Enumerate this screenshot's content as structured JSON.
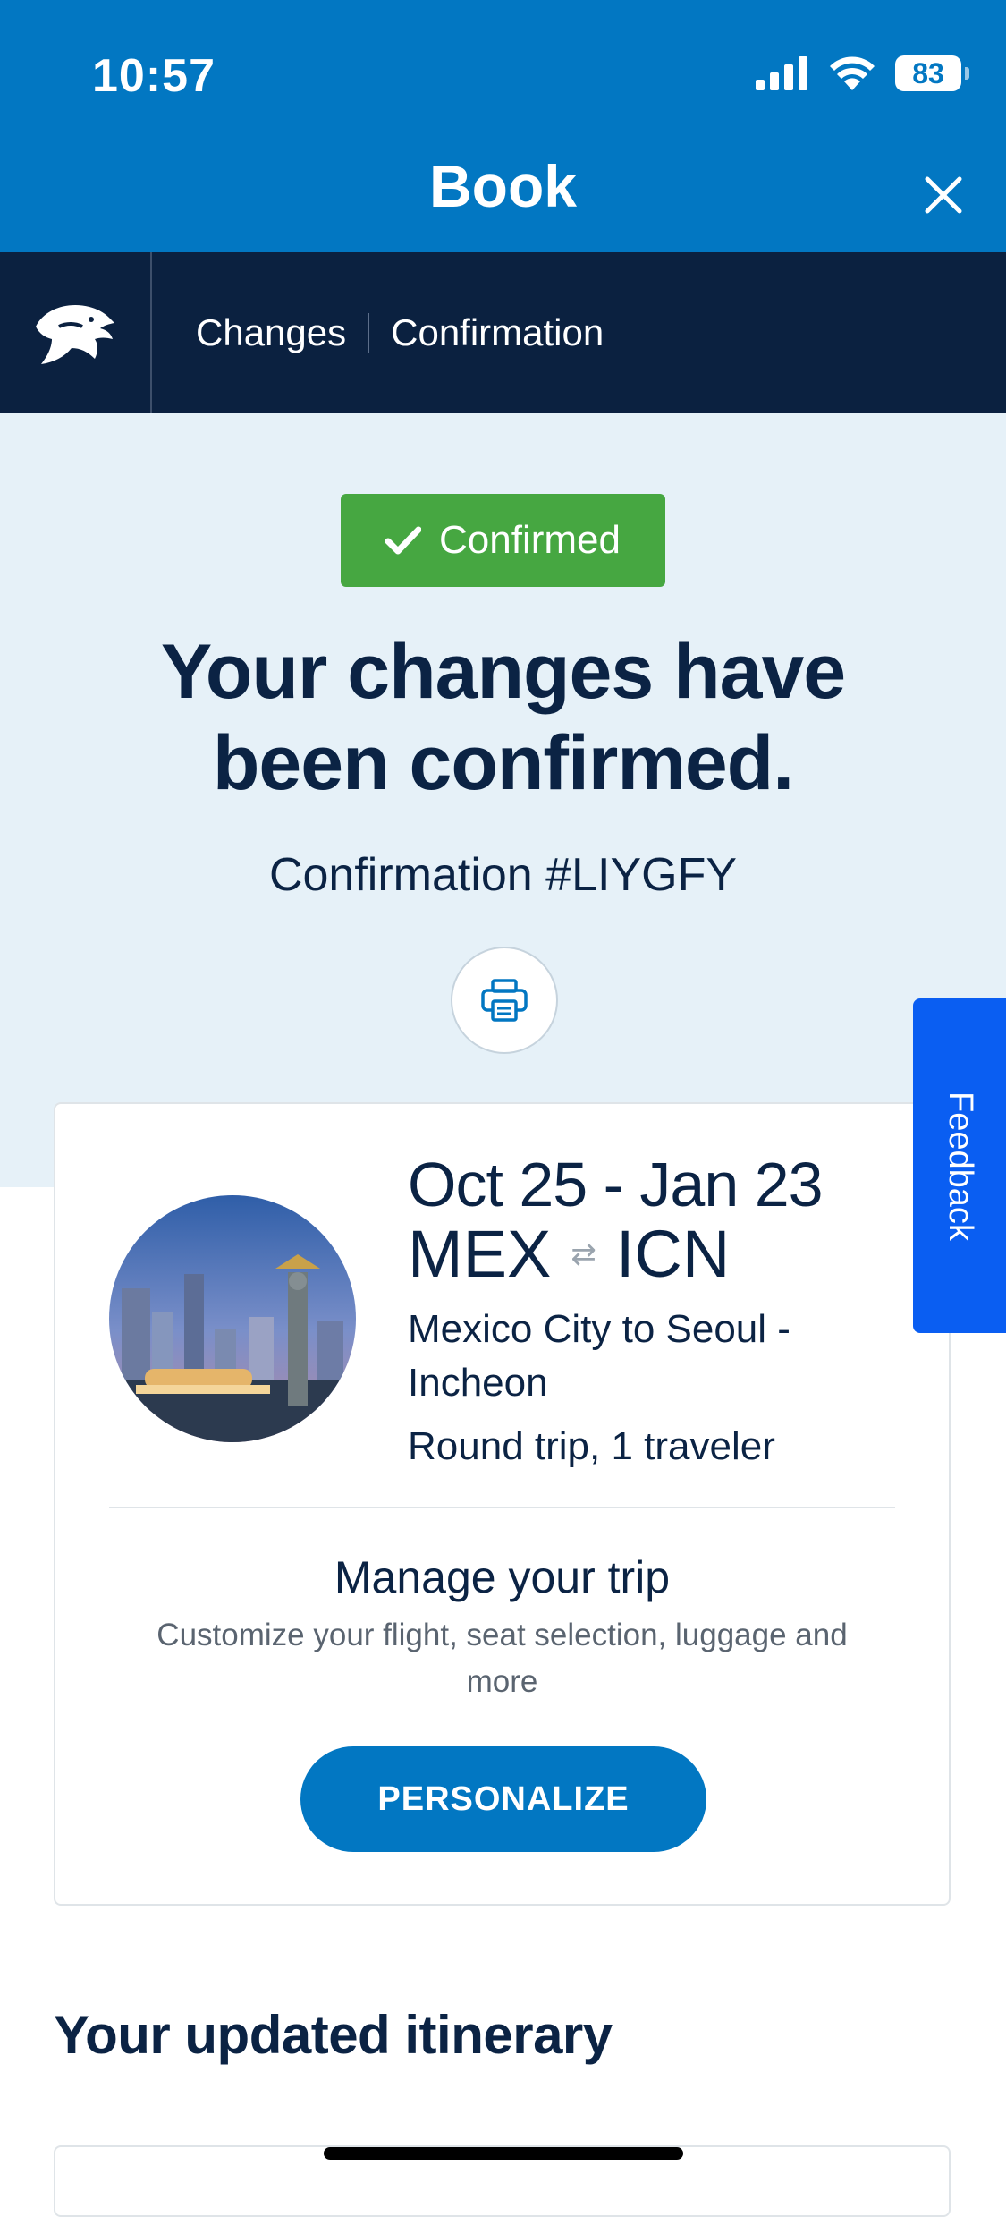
{
  "status_bar": {
    "time": "10:57",
    "battery": "83"
  },
  "header": {
    "title": "Book"
  },
  "breadcrumb": {
    "items": [
      "Changes",
      "Confirmation"
    ]
  },
  "confirmation": {
    "badge": "Confirmed",
    "headline_line1": "Your changes have",
    "headline_line2": "been confirmed.",
    "number": "Confirmation #LIYGFY"
  },
  "trip": {
    "dates": "Oct 25 - Jan 23",
    "origin": "MEX",
    "destination": "ICN",
    "route_arrows": "⇄",
    "city_line1": "Mexico City to Seoul -",
    "city_line2": "Incheon",
    "type": "Round trip, 1 traveler",
    "manage_title": "Manage your trip",
    "manage_subtitle": "Customize your flight, seat selection, luggage and more",
    "button": "PERSONALIZE"
  },
  "feedback": {
    "label": "Feedback"
  },
  "section": {
    "title": "Your updated itinerary"
  },
  "colors": {
    "brand_blue": "#0277c2",
    "navy": "#0b2140",
    "success_green": "#46a741",
    "feedback_blue": "#0a5ef2"
  },
  "icons": [
    "signal-icon",
    "wifi-icon",
    "battery-icon",
    "close-icon",
    "eagle-logo-icon",
    "check-icon",
    "printer-icon"
  ]
}
